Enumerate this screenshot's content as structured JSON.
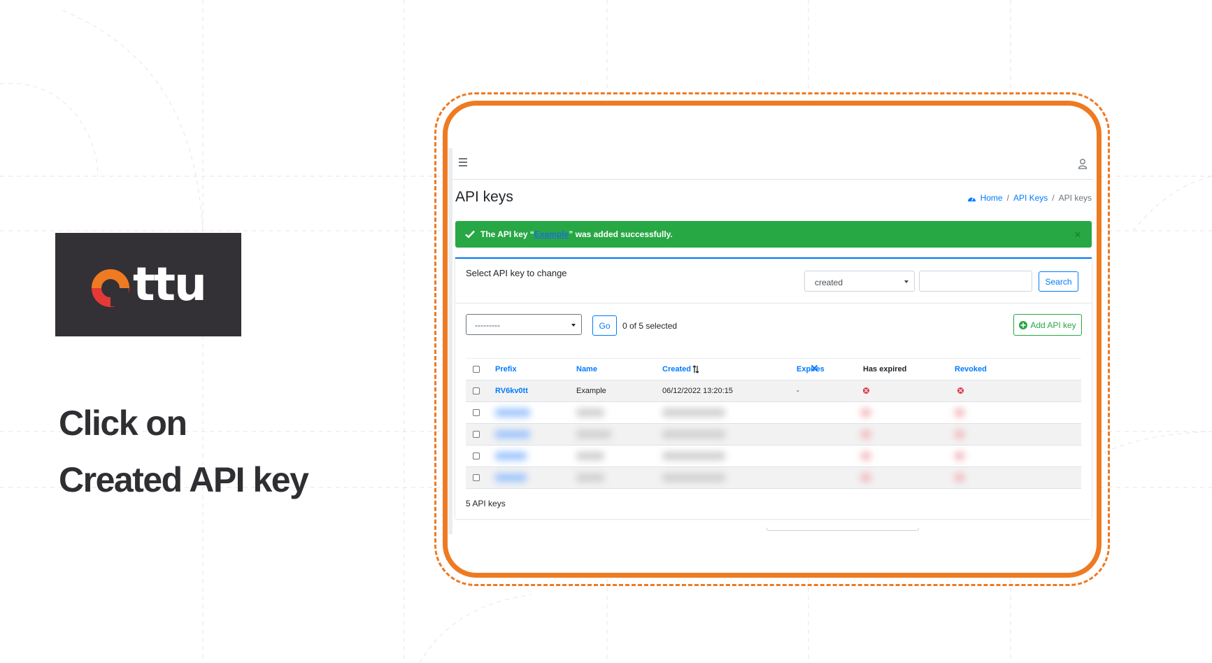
{
  "brand": {
    "logo_text": "ttu",
    "logo_full": "Ottu",
    "colors": {
      "orange": "#ee7a22",
      "red": "#e53935",
      "dark": "#333135"
    }
  },
  "headline": {
    "line1": "Click on",
    "line2": "Created API key"
  },
  "app": {
    "page_title": "API keys",
    "breadcrumb": [
      {
        "label": "Home",
        "icon": "dashboard-icon"
      },
      {
        "label": "API Keys"
      },
      {
        "label": "API keys"
      }
    ],
    "alert": {
      "prefix": "The API key “",
      "link": "Example",
      "suffix": "” was added successfully.",
      "close": "×"
    },
    "card": {
      "title": "Select API key to change",
      "sort_select": "created",
      "search_value": "",
      "search_button": "Search",
      "action_select": "---------",
      "go_button": "Go",
      "selected_count": "0 of 5 selected",
      "add_button": "Add API key",
      "columns": [
        "Prefix",
        "Name",
        "Created",
        "Expires",
        "Has expired",
        "Revoked"
      ],
      "rows": [
        {
          "prefix": "RV6kv0tt",
          "name": "Example",
          "created": "06/12/2022 13:20:15",
          "expires": "-",
          "has_expired": "error-icon",
          "revoked": "error-icon"
        }
      ],
      "footer": "5 API keys"
    }
  }
}
